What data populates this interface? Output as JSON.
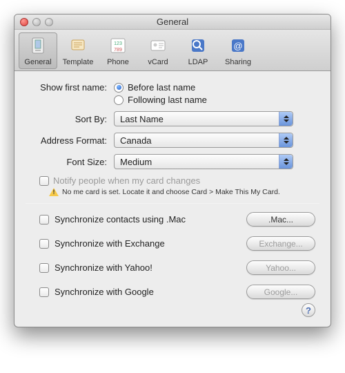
{
  "window": {
    "title": "General"
  },
  "toolbar": {
    "items": [
      {
        "label": "General"
      },
      {
        "label": "Template"
      },
      {
        "label": "Phone"
      },
      {
        "label": "vCard"
      },
      {
        "label": "LDAP"
      },
      {
        "label": "Sharing"
      }
    ]
  },
  "showFirst": {
    "label": "Show first name:",
    "before": "Before last name",
    "following": "Following last name"
  },
  "sortBy": {
    "label": "Sort By:",
    "value": "Last Name"
  },
  "addressFormat": {
    "label": "Address Format:",
    "value": "Canada"
  },
  "fontSize": {
    "label": "Font Size:",
    "value": "Medium"
  },
  "notify": {
    "label": "Notify people when my card changes",
    "warning": "No me card is set. Locate it and choose Card > Make This My Card."
  },
  "sync": {
    "mac": {
      "label": "Synchronize contacts using .Mac",
      "button": ".Mac..."
    },
    "exchange": {
      "label": "Synchronize with Exchange",
      "button": "Exchange..."
    },
    "yahoo": {
      "label": "Synchronize with Yahoo!",
      "button": "Yahoo..."
    },
    "google": {
      "label": "Synchronize with Google",
      "button": "Google..."
    }
  },
  "help": "?"
}
